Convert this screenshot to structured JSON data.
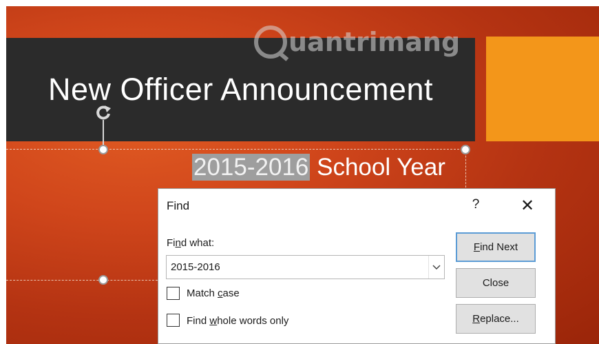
{
  "slide": {
    "watermark_text": "uantrimang",
    "title": "New Officer Announcement",
    "subtitle_highlight": "2015-2016",
    "subtitle_rest": " School Year"
  },
  "dialog": {
    "title": "Find",
    "help": "?",
    "close": "✕",
    "find_what_label": {
      "pre": "Fi",
      "accel": "n",
      "post": "d what:"
    },
    "find_what_value": "2015-2016",
    "match_case": {
      "pre": "Match ",
      "accel": "c",
      "post": "ase",
      "checked": false
    },
    "whole_words": {
      "pre": "Find ",
      "accel": "w",
      "post": "hole words only",
      "checked": false
    },
    "buttons": {
      "find_next": {
        "accel": "F",
        "post": "ind Next"
      },
      "close": {
        "label": "Close"
      },
      "replace": {
        "accel": "R",
        "post": "eplace..."
      }
    }
  },
  "colors": {
    "slide_orange": "#d0461b",
    "title_bar": "#2b2b2b",
    "accent_block": "#f3961a",
    "highlight": "#9e9e9e",
    "focus_border": "#5b9bd5"
  },
  "icons": {
    "rotate": "rotate-handle-icon",
    "dropdown": "chevron-down-icon",
    "logo": "quantrimang-logo-icon"
  }
}
